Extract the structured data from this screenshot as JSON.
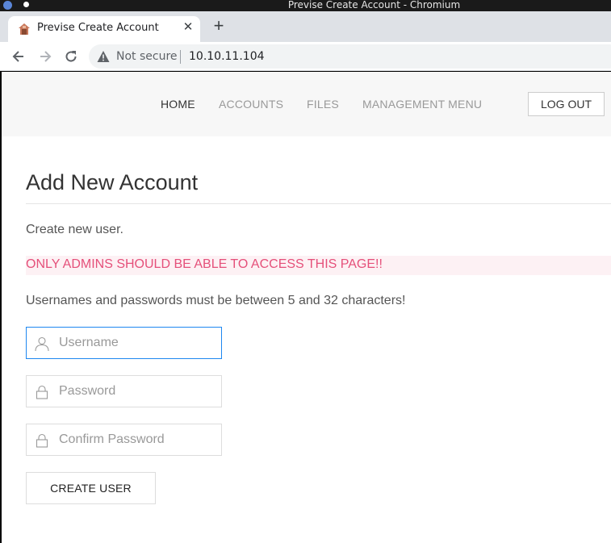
{
  "window": {
    "title": "Previse Create Account - Chromium"
  },
  "tab": {
    "title": "Previse Create Account",
    "close_glyph": "✕",
    "new_tab_glyph": "+"
  },
  "address_bar": {
    "security_label": "Not secure",
    "url": "10.10.11.104"
  },
  "navbar": {
    "links": [
      "HOME",
      "ACCOUNTS",
      "FILES",
      "MANAGEMENT MENU"
    ],
    "active": "HOME",
    "logout_label": "LOG OUT"
  },
  "page": {
    "heading": "Add New Account",
    "intro": "Create new user.",
    "warning": "ONLY ADMINS SHOULD BE ABLE TO ACCESS THIS PAGE!!",
    "rules": "Usernames and passwords must be between 5 and 32 characters!"
  },
  "form": {
    "username": {
      "value": "",
      "placeholder": "Username",
      "icon": "user-icon"
    },
    "password": {
      "value": "",
      "placeholder": "Password",
      "icon": "lock-icon"
    },
    "confirm": {
      "value": "",
      "placeholder": "Confirm Password",
      "icon": "lock-icon"
    },
    "submit_label": "CREATE USER"
  },
  "colors": {
    "accent_focus": "#1e87f0",
    "warning_text": "#e5507a",
    "warning_bg": "#fdf1f4"
  }
}
